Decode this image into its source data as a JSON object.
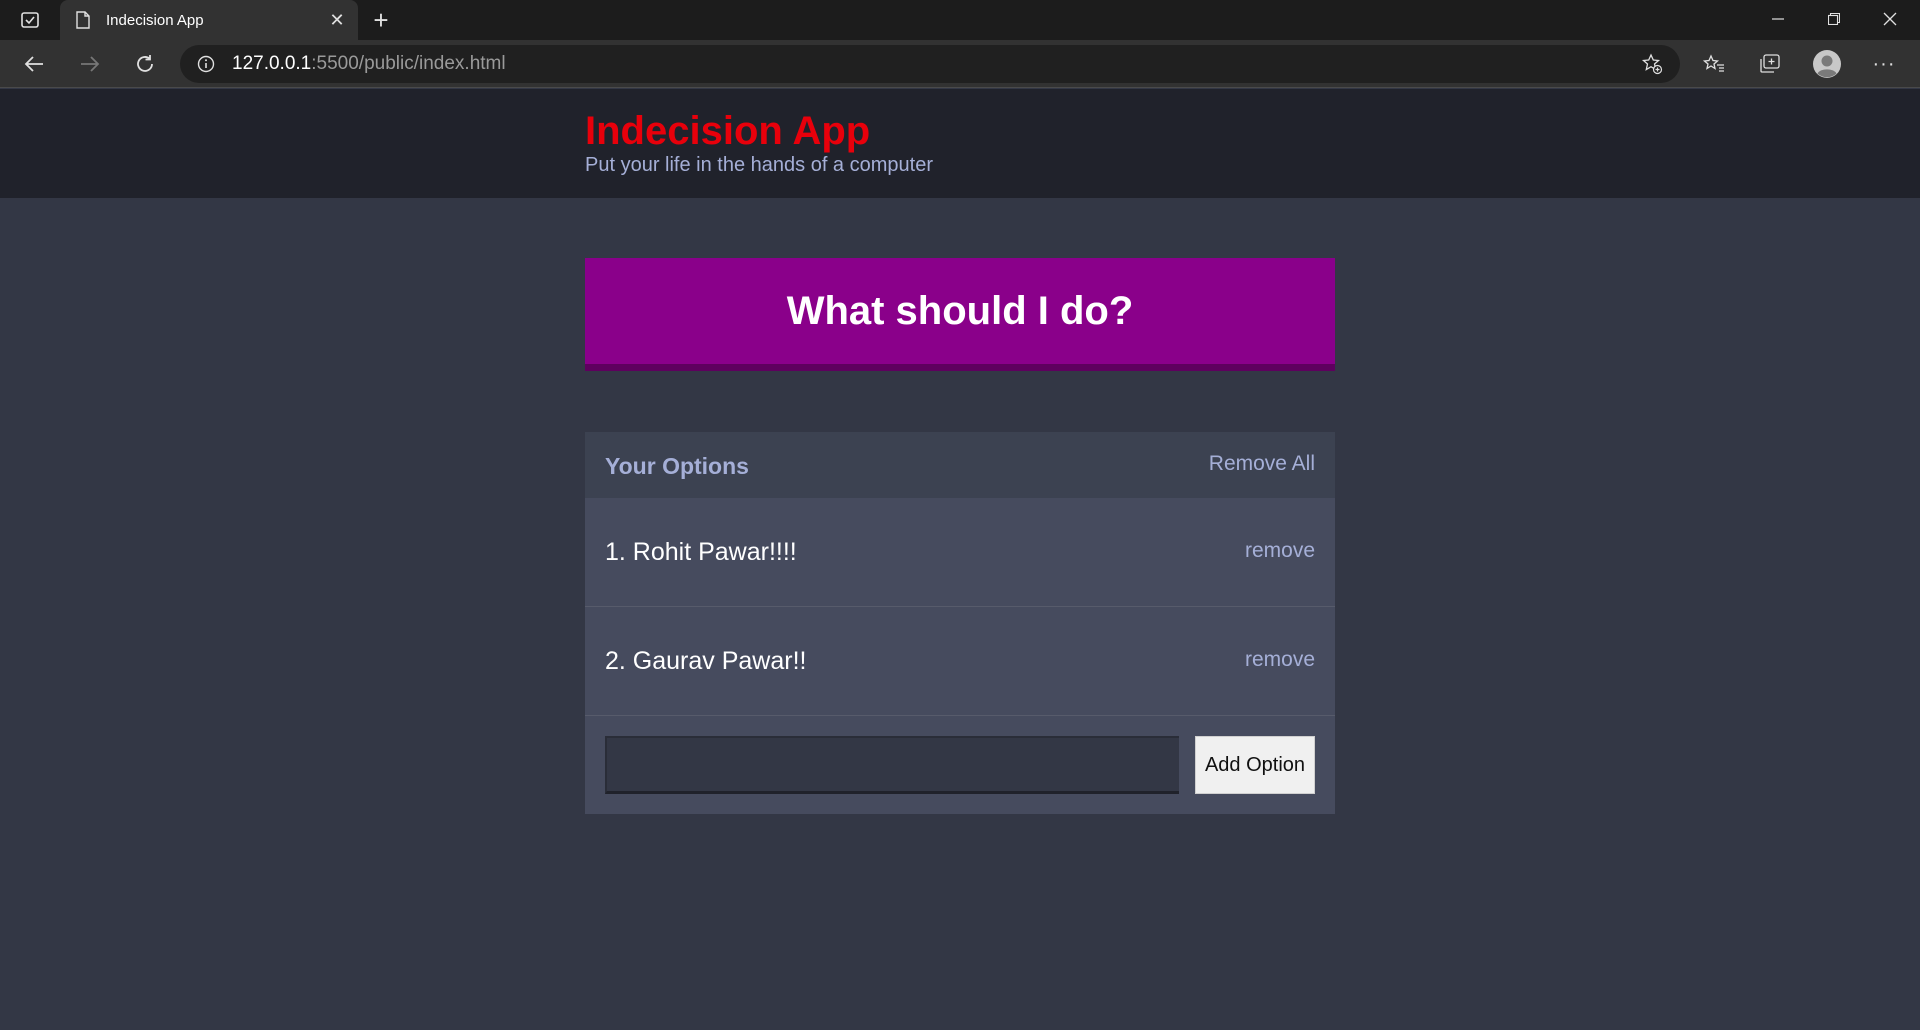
{
  "browser": {
    "tab_title": "Indecision App",
    "url_host": "127.0.0.1",
    "url_rest": ":5500/public/index.html",
    "more_label": "···"
  },
  "app": {
    "title": "Indecision App",
    "subtitle": "Put your life in the hands of a computer",
    "action_label": "What should I do?"
  },
  "options_widget": {
    "title": "Your Options",
    "remove_all_label": "Remove All",
    "items": [
      {
        "text": "1. Rohit Pawar!!!!",
        "remove_label": "remove"
      },
      {
        "text": "2. Gaurav Pawar!!",
        "remove_label": "remove"
      }
    ],
    "input_value": "",
    "add_button_label": "Add Option"
  },
  "colors": {
    "title_red": "#e8000b",
    "button_purple": "#8a008a",
    "accent_lavender": "#a5afd7",
    "page_bg": "#333745",
    "header_bg": "#20222b"
  }
}
